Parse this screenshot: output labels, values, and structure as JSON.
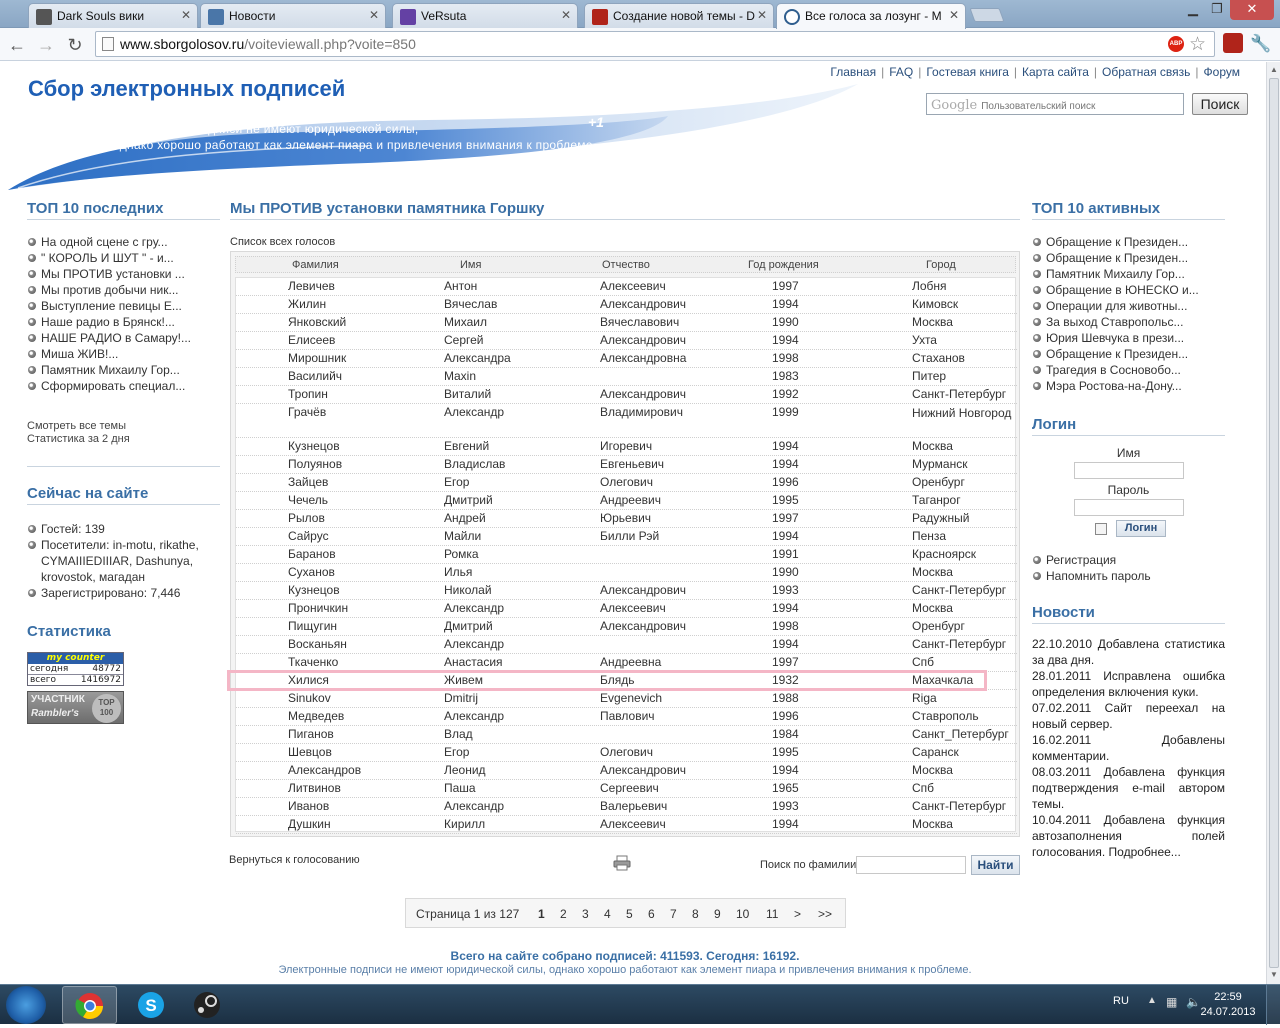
{
  "browser": {
    "tabs": [
      {
        "title": "Dark Souls вики",
        "color": "#555"
      },
      {
        "title": "Новости",
        "color": "#4a76a8"
      },
      {
        "title": "VeRsuta",
        "color": "#6441a4"
      },
      {
        "title": "Создание новой темы - D",
        "color": "#b0241a"
      },
      {
        "title": "Все голоса за лозунг - М",
        "color": "#2f5e8e"
      }
    ],
    "url_host": "www.sborgolosov.ru",
    "url_rest": "/voiteviewall.php?voite=850"
  },
  "header": {
    "site_title": "Сбор электронных подписей",
    "banner_line1": "Электронные подписи не имеют юридической силы,",
    "banner_line2": "однако хорошо работают как элемент пиара и привлечения внимания к проблеме.",
    "banner_badge": "+1",
    "nav": [
      "Главная",
      "FAQ",
      "Гостевая книга",
      "Карта сайта",
      "Обратная связь",
      "Форум"
    ],
    "search_placeholder": "Пользовательский поиск",
    "search_brand": "Google",
    "search_button": "Поиск"
  },
  "left": {
    "top10_title": "ТОП 10 последних",
    "top10": [
      "На одной сцене с гру...",
      "\" КОРОЛЬ И ШУТ \" - и...",
      "Мы ПРОТИВ установки ...",
      "Мы против добычи ник...",
      "Выступление певицы Е...",
      "Наше радио в Брянск!...",
      "НАШЕ РАДИО в Самару!...",
      "Миша ЖИВ!...",
      "Памятник Михаилу Гор...",
      "Сформировать специал..."
    ],
    "all_topics": "Смотреть все темы",
    "stats_2days": "Статистика за 2 дня",
    "online_title": "Сейчас на сайте",
    "guests": "Гостей: 139",
    "visitors": "Посетители: in-motu, rikathe, CYMAIIIEDIIIAR, Dashunya, krovostok, магадан",
    "registered": "Зарегистрировано: 7,446",
    "stat_title": "Статистика",
    "counter": {
      "brand": "my counter",
      "today_label": "сегодня",
      "today": "48772",
      "total_label": "всего",
      "total": "1416972"
    },
    "rambler": {
      "label1": "УЧАСТНИК",
      "label2": "Rambler's",
      "top": "TOP",
      "num": "100"
    }
  },
  "main": {
    "title": "Мы ПРОТИВ установки памятника Горшку",
    "list_label": "Список всех голосов",
    "columns": [
      "Фамилия",
      "Имя",
      "Отчество",
      "Год рождения",
      "Город"
    ],
    "rows": [
      [
        "Левичев",
        "Антон",
        "Алексеевич",
        "1997",
        "Лобня"
      ],
      [
        "Жилин",
        "Вячеслав",
        "Александрович",
        "1994",
        "Кимовск"
      ],
      [
        "Янковский",
        "Михаил",
        "Вячеславович",
        "1990",
        "Москва"
      ],
      [
        "Елисеев",
        "Сергей",
        "Александрович",
        "1994",
        "Ухта"
      ],
      [
        "Мирошник",
        "Александра",
        "Александровна",
        "1998",
        "Стаханов"
      ],
      [
        "Василийч",
        "Maxin",
        "",
        "1983",
        "Питер"
      ],
      [
        "Тропин",
        "Виталий",
        "Александрович",
        "1992",
        "Санкт-Петербург"
      ],
      [
        "Грачёв",
        "Александр",
        "Владимирович",
        "1999",
        "Нижний Новгород"
      ],
      [
        "Кузнецов",
        "Евгений",
        "Игоревич",
        "1994",
        "Москва"
      ],
      [
        "Полуянов",
        "Владислав",
        "Евгеньевич",
        "1994",
        "Мурманск"
      ],
      [
        "Зайцев",
        "Егор",
        "Олегович",
        "1996",
        "Оренбург"
      ],
      [
        "Чечель",
        "Дмитрий",
        "Андреевич",
        "1995",
        "Таганрог"
      ],
      [
        "Рылов",
        "Андрей",
        "Юрьевич",
        "1997",
        "Радужный"
      ],
      [
        "Сайрус",
        "Майли",
        "Билли Рэй",
        "1994",
        "Пенза"
      ],
      [
        "Баранов",
        "Ромка",
        "",
        "1991",
        "Красноярск"
      ],
      [
        "Суханов",
        "Илья",
        "",
        "1990",
        "Москва"
      ],
      [
        "Кузнецов",
        "Николай",
        "Александрович",
        "1993",
        "Санкт-Петербург"
      ],
      [
        "Проничкин",
        "Александр",
        "Алексеевич",
        "1994",
        "Москва"
      ],
      [
        "Пищугин",
        "Дмитрий",
        "Александрович",
        "1998",
        "Оренбург"
      ],
      [
        "Восканьян",
        "Александр",
        "",
        "1994",
        "Санкт-Петербург"
      ],
      [
        "Ткаченко",
        "Анастасия",
        "Андреевна",
        "1997",
        "Спб"
      ],
      [
        "Хилися",
        "Живем",
        "Блядь",
        "1932",
        "Махачкала"
      ],
      [
        "Sinukov",
        "Dmitrij",
        "Evgenevich",
        "1988",
        "Riga"
      ],
      [
        "Медведев",
        "Александр",
        "Павлович",
        "1996",
        "Ставрополь"
      ],
      [
        "Пиганов",
        "Влад",
        "",
        "1984",
        "Санкт_Петербург"
      ],
      [
        "Шевцов",
        "Егор",
        "Олегович",
        "1995",
        "Саранск"
      ],
      [
        "Александров",
        "Леонид",
        "Александрович",
        "1994",
        "Москва"
      ],
      [
        "Литвинов",
        "Паша",
        "Сергеевич",
        "1965",
        "Спб"
      ],
      [
        "Иванов",
        "Александр",
        "Валерьевич",
        "1993",
        "Санкт-Петербург"
      ],
      [
        "Душкин",
        "Кирилл",
        "Алексеевич",
        "1994",
        "Москва"
      ]
    ],
    "back_link": "Вернуться к голосованию",
    "search_label": "Поиск по фамилии",
    "search_button": "Найти",
    "pager": {
      "info": "Страница 1 из 127",
      "pages": [
        "1",
        "2",
        "3",
        "4",
        "5",
        "6",
        "7",
        "8",
        "9",
        "10",
        "11"
      ],
      "next": ">",
      "last": ">>",
      "current": "1"
    },
    "total": "Всего на сайте собрано подписей: 411593. Сегодня: 16192.",
    "footer_note": "Электронные подписи не имеют юридической силы, однако хорошо работают как элемент пиара и привлечения внимания к проблеме."
  },
  "right": {
    "top10_title": "ТОП 10 активных",
    "top10": [
      "Обращение к Президен...",
      "Обращение к Президен...",
      "Памятник Михаилу Гор...",
      "Обращение в ЮНЕСКО и...",
      "Операции для животны...",
      "За выход Ставропольс...",
      "Юрия Шевчука в прези...",
      "Обращение к Президен...",
      "Трагедия в Сосновобо...",
      "Мэра Ростова-на-Дону..."
    ],
    "login_title": "Логин",
    "name_label": "Имя",
    "pass_label": "Пароль",
    "login_button": "Логин",
    "register": "Регистрация",
    "remind": "Напомнить пароль",
    "news_title": "Новости",
    "news": [
      "22.10.2010 Добавлена статистика за два дня.",
      "28.01.2011 Исправлена ошибка определения включения куки.",
      "07.02.2011 Сайт переехал на новый сервер.",
      "16.02.2011 Добавлены комментарии.",
      "08.03.2011 Добавлена функция подтверждения e-mail автором темы.",
      "10.04.2011 Добавлена функция автозаполнения полей голосования. Подробнее..."
    ]
  },
  "taskbar": {
    "lang": "RU",
    "time": "22:59",
    "date": "24.07.2013"
  }
}
